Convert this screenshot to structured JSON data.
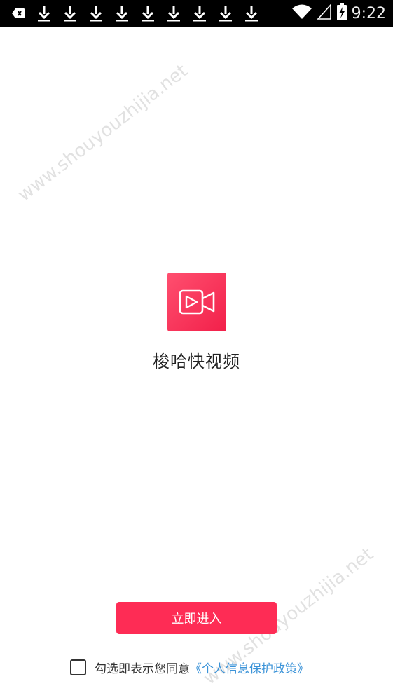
{
  "status_bar": {
    "time": "9:22",
    "notification_icons": [
      "app-notification-icon",
      "download-icon",
      "download-icon",
      "download-icon",
      "download-icon",
      "download-icon",
      "download-icon",
      "download-icon",
      "download-icon",
      "download-icon"
    ],
    "right_icons": [
      "wifi-icon",
      "signal-icon",
      "battery-charging-icon"
    ]
  },
  "watermark": {
    "text_top": "www.shouyouzhijia.net",
    "text_bottom": "www.shouyouzhijia.net"
  },
  "app": {
    "icon": "video-camera-icon",
    "name": "梭哈快视频",
    "brand_color": "#fe2c55"
  },
  "actions": {
    "enter_label": "立即进入"
  },
  "agreement": {
    "text": "勾选即表示您同意",
    "policy_link": "《个人信息保护政策》",
    "checked": false,
    "link_color": "#3b93d8"
  }
}
